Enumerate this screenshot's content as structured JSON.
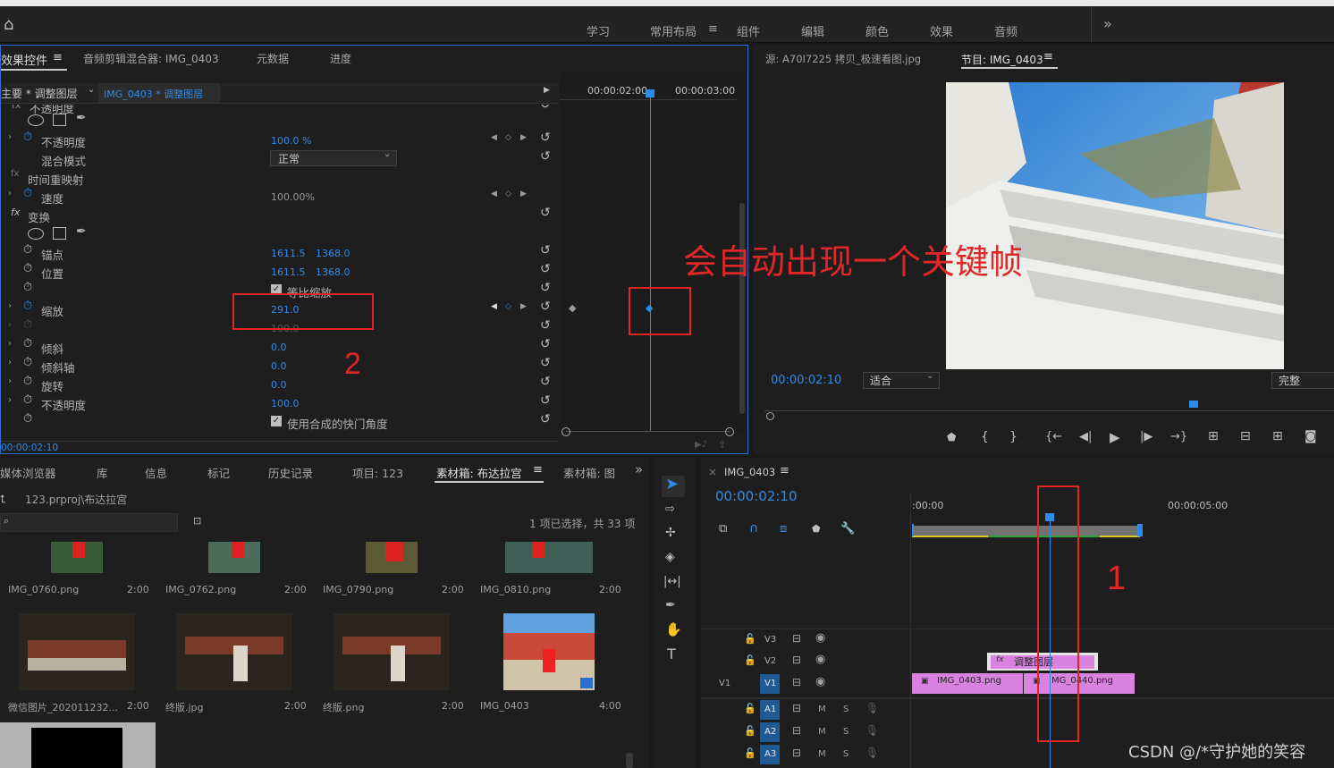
{
  "menubar": {
    "text": ""
  },
  "workspaces": {
    "items": [
      "学习",
      "常用布局",
      "组件",
      "编辑",
      "颜色",
      "效果",
      "音频"
    ],
    "active_icon": "≡",
    "more": "»"
  },
  "effect_controls": {
    "tabs": [
      "效果控件",
      "音频剪辑混合器: IMG_0403",
      "元数据",
      "进度"
    ],
    "tab_menu": "≡",
    "clip_label": "主要 * 调整图层",
    "clip_link": "IMG_0403 * 调整图层",
    "ruler": [
      "00:00:02:00",
      "00:00:03:00"
    ],
    "rows": {
      "opacity_head": "不透明度",
      "opacity": "不透明度",
      "opacity_val": "100.0 %",
      "blend": "混合模式",
      "blend_val": "正常",
      "timeremap": "时间重映射",
      "speed": "速度",
      "speed_val": "100.00%",
      "transform": "变换",
      "anchor": "锚点",
      "anchor_x": "1611.5",
      "anchor_y": "1368.0",
      "position": "位置",
      "position_x": "1611.5",
      "position_y": "1368.0",
      "uniform": "等比缩放",
      "scale": "缩放",
      "scale_val": "291.0",
      "scale_w": "100.0",
      "skew": "倾斜",
      "skew_val": "0.0",
      "skew_axis": "倾斜轴",
      "skew_axis_val": "0.0",
      "rotate": "旋转",
      "rotate_val": "0.0",
      "opacity2": "不透明度",
      "opacity2_val": "100.0",
      "shutter": "使用合成的快门角度"
    },
    "timecode": "00:00:02:10",
    "fx": "fx"
  },
  "annotations": {
    "keyframe_note": "会自动出现一个关键帧",
    "num1": "1",
    "num2": "2",
    "watermark": "CSDN @/*守护她的笑容"
  },
  "program": {
    "source_tab": "源: A70I7225 拷贝_极速看图.jpg",
    "program_tab": "节目: IMG_0403",
    "tab_menu": "≡",
    "timecode": "00:00:02:10",
    "fit": "适合",
    "quality": "完整"
  },
  "project": {
    "tabs": [
      "媒体浏览器",
      "库",
      "信息",
      "标记",
      "历史记录",
      "项目: 123",
      "素材箱: 布达拉宫",
      "素材箱: 图"
    ],
    "tab_menu": "≡",
    "more": "»",
    "path": "123.prproj\\布达拉宫",
    "selection": "1 项已选择，共 33 项",
    "items": [
      {
        "name": "IMG_0760.png",
        "dur": "2:00"
      },
      {
        "name": "IMG_0762.png",
        "dur": "2:00"
      },
      {
        "name": "IMG_0790.png",
        "dur": "2:00"
      },
      {
        "name": "IMG_0810.png",
        "dur": "2:00"
      },
      {
        "name": "微信图片_202011232...",
        "dur": "2:00"
      },
      {
        "name": "终版.jpg",
        "dur": "2:00"
      },
      {
        "name": "终版.png",
        "dur": "2:00"
      },
      {
        "name": "IMG_0403",
        "dur": "4:00"
      }
    ]
  },
  "timeline": {
    "title": "IMG_0403",
    "title_menu": "≡",
    "close": "×",
    "timecode": "00:00:02:10",
    "ruler": [
      ":00:00",
      "00:00:05:00"
    ],
    "tracks": [
      {
        "src": "",
        "name": "V3",
        "m": "",
        "s": ""
      },
      {
        "src": "",
        "name": "V2",
        "m": "",
        "s": ""
      },
      {
        "src": "V1",
        "name": "V1",
        "m": "",
        "s": ""
      },
      {
        "src": "",
        "name": "A1",
        "m": "M",
        "s": "S"
      },
      {
        "src": "",
        "name": "A2",
        "m": "M",
        "s": "S"
      },
      {
        "src": "",
        "name": "A3",
        "m": "M",
        "s": "S"
      }
    ],
    "clips": {
      "adjust": "调整图层",
      "c1": "IMG_0403.png",
      "c2": "IMG_0440.png",
      "fx": "fx"
    }
  },
  "colors": {
    "accent": "#2d8ceb",
    "annotation": "#e02626",
    "clip": "#d982e0"
  }
}
